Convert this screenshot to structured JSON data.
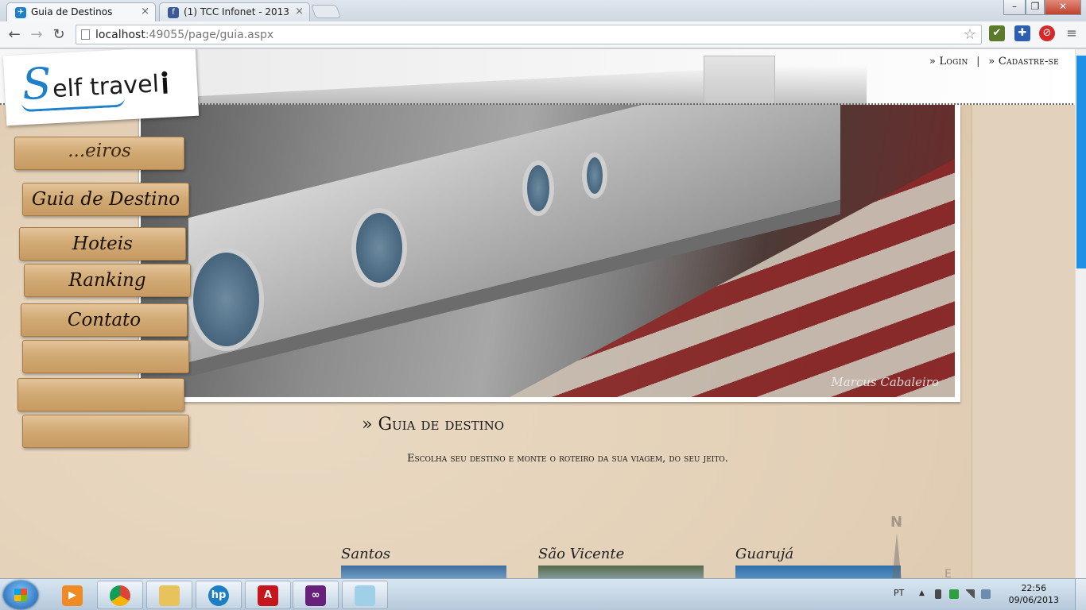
{
  "browser": {
    "tabs": [
      {
        "title": "Guia de Destinos",
        "active": true
      },
      {
        "title": "(1) TCC Infonet - 2013",
        "active": false
      }
    ],
    "url_host": "localhost",
    "url_rest": ":49055/page/guia.aspx",
    "icons": {
      "back": "back-arrow-icon",
      "forward": "forward-arrow-icon",
      "reload": "reload-icon",
      "bookmark": "star-icon"
    }
  },
  "site": {
    "logo_initial": "S",
    "logo_text": "elf travel",
    "auth": {
      "login": "» Login",
      "separator": "|",
      "signup": "» Cadastre-se"
    },
    "menu": [
      {
        "label": "...eiros",
        "visible_partial": true
      },
      {
        "label": "Guia de Destino"
      },
      {
        "label": "Hoteis"
      },
      {
        "label": "Ranking"
      },
      {
        "label": "Contato"
      }
    ],
    "hero_credit": "Marcus Cabaleiro",
    "guide_title": "» Guia de destino",
    "guide_subtitle": "Escolha seu destino e monte o roteiro da sua viagem, do seu jeito.",
    "destinations": [
      "Santos",
      "São Vicente",
      "Guarujá"
    ],
    "compass": {
      "n": "N",
      "e": "E"
    }
  },
  "taskbar": {
    "language": "PT",
    "time": "22:56",
    "date": "09/06/2013"
  },
  "colors": {
    "accent": "#1e80c8",
    "scrollbar": "#1e90e6"
  }
}
